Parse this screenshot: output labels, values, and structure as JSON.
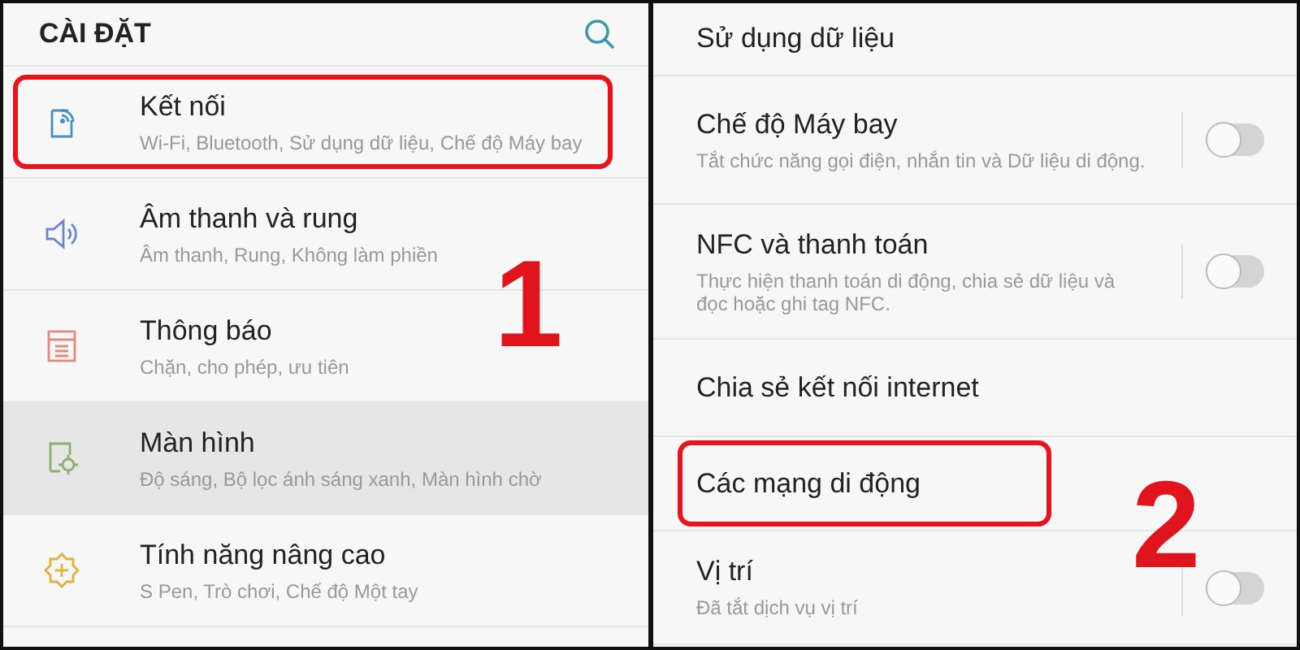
{
  "left_screen": {
    "title": "CÀI ĐẶT",
    "items": [
      {
        "kind": "connections",
        "title": "Kết nối",
        "subtitle": "Wi-Fi, Bluetooth, Sử dụng dữ liệu, Chế độ Máy bay",
        "highlighted": true,
        "pressed": false
      },
      {
        "kind": "sound",
        "title": "Âm thanh và rung",
        "subtitle": "Âm thanh, Rung, Không làm phiền",
        "highlighted": false,
        "pressed": false
      },
      {
        "kind": "notifications",
        "title": "Thông báo",
        "subtitle": "Chặn, cho phép, ưu tiên",
        "highlighted": false,
        "pressed": false
      },
      {
        "kind": "display",
        "title": "Màn hình",
        "subtitle": "Độ sáng, Bộ lọc ánh sáng xanh, Màn hình chờ",
        "highlighted": false,
        "pressed": true
      },
      {
        "kind": "advanced",
        "title": "Tính năng nâng cao",
        "subtitle": "S Pen, Trò chơi, Chế độ Một tay",
        "highlighted": false,
        "pressed": false
      }
    ],
    "step_number": "1"
  },
  "right_screen": {
    "items": [
      {
        "kind": "plain",
        "title": "Sử dụng dữ liệu",
        "highlighted": false
      },
      {
        "kind": "toggle",
        "title": "Chế độ Máy bay",
        "subtitle": "Tắt chức năng gọi điện, nhắn tin và Dữ liệu di động.",
        "on": false,
        "highlighted": false
      },
      {
        "kind": "toggle",
        "title": "NFC và thanh toán",
        "subtitle": "Thực hiện thanh toán di động, chia sẻ dữ liệu và đọc hoặc ghi tag NFC.",
        "on": false,
        "highlighted": false
      },
      {
        "kind": "plain",
        "title": "Chia sẻ kết nối internet",
        "highlighted": false
      },
      {
        "kind": "plain",
        "title": "Các mạng di động",
        "highlighted": true
      },
      {
        "kind": "toggle",
        "title": "Vị trí",
        "subtitle": "Đã tắt dịch vụ vị trí",
        "on": false,
        "highlighted": false
      }
    ],
    "step_number": "2"
  }
}
